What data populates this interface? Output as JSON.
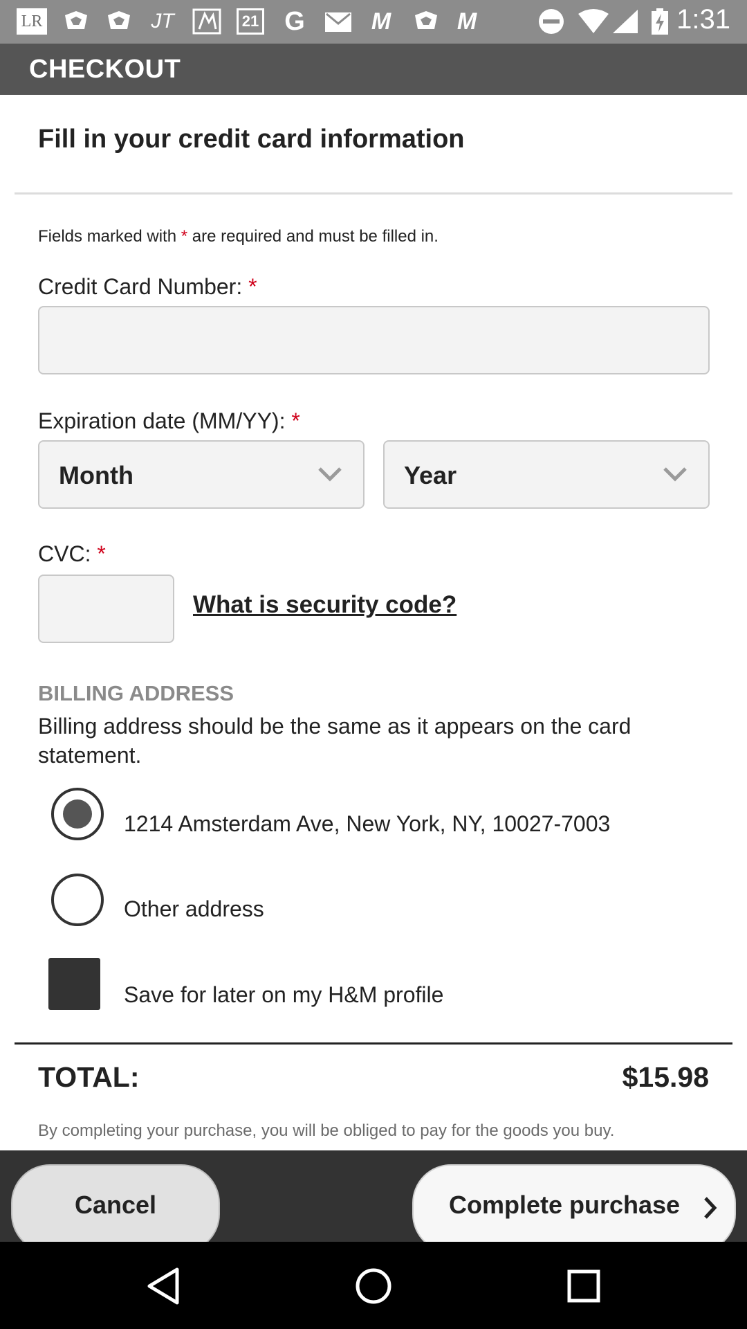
{
  "status_bar": {
    "time": "1:31",
    "notification_icons": [
      "LR",
      "notification-icon",
      "notification-icon",
      "JT",
      "notification-icon",
      "21",
      "G",
      "mail-icon",
      "M",
      "notification-icon",
      "M"
    ],
    "system_icons": [
      "do-not-disturb-icon",
      "wifi-icon",
      "signal-icon",
      "battery-charging-icon"
    ]
  },
  "app_bar": {
    "title": "CHECKOUT"
  },
  "form": {
    "heading": "Fill in your credit card information",
    "required_note_before": "Fields marked with ",
    "required_mark": "*",
    "required_note_after": " are required and must be filled in.",
    "card_number_label": "Credit Card Number: ",
    "card_number_value": "",
    "expiration_label": "Expiration date (MM/YY): ",
    "month_select": "Month",
    "year_select": "Year",
    "cvc_label": "CVC: ",
    "cvc_value": "",
    "security_code_link": "What is security code?"
  },
  "billing": {
    "title": "BILLING ADDRESS",
    "description": "Billing address should be the same as it appears on the card statement.",
    "options": [
      {
        "label": "1214 Amsterdam Ave, New York, NY, 10027-7003",
        "selected": true
      },
      {
        "label": "Other address",
        "selected": false
      }
    ],
    "save_label": "Save for later on my H&M profile"
  },
  "summary": {
    "total_label": "TOTAL:",
    "total_value": "$15.98",
    "legal_text": "By completing your purchase, you will be obliged to pay for the goods you buy."
  },
  "actions": {
    "cancel_label": "Cancel",
    "complete_label": "Complete purchase"
  },
  "colors": {
    "status_bar": "#8c8c8c",
    "app_bar": "#555555",
    "required": "#d0021b",
    "action_bar": "#333333"
  }
}
